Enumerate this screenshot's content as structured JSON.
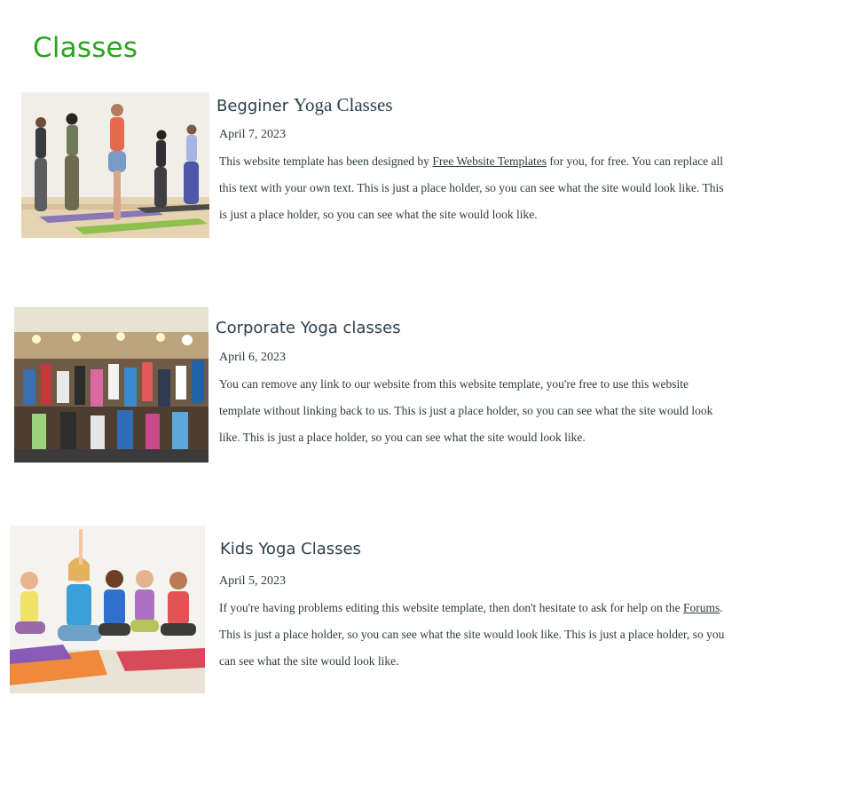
{
  "page": {
    "title": "Classes"
  },
  "classes": [
    {
      "title_sans": "Begginer ",
      "title_serif": "Yoga Classes",
      "date": "April 7, 2023",
      "desc_before": "This website template has been designed by ",
      "desc_link": "Free Website Templates",
      "desc_after": " for you, for free. You can replace all this text with your own text. This is just a place holder, so you can see what the site would look like. This is just a place holder, so you can see what the site would look like.",
      "image": "standing-yoga-pose-photo"
    },
    {
      "title": "Corporate Yoga classes",
      "date": "April 6, 2023",
      "desc": "You can remove any link to our website from this website template, you're free to use this website template without linking back to us. This is just a place holder, so you can see what the site would look like. This is just a place holder, so you can see what the site would look like.",
      "image": "group-yoga-class-photo"
    },
    {
      "title": "Kids Yoga Classes",
      "date": "April 5, 2023",
      "desc_before": "If you're having problems editing this website template, then don't hesitate to ask for help on the ",
      "desc_link": "Forums",
      "desc_after": ". This is just a place holder, so you can see what the site would look like. This is just a place holder, so you can see what the site would look like.",
      "image": "kids-yoga-photo"
    }
  ],
  "colors": {
    "title_green": "#2aa31f",
    "heading": "#2c3f4d",
    "text": "#2f3b36"
  }
}
